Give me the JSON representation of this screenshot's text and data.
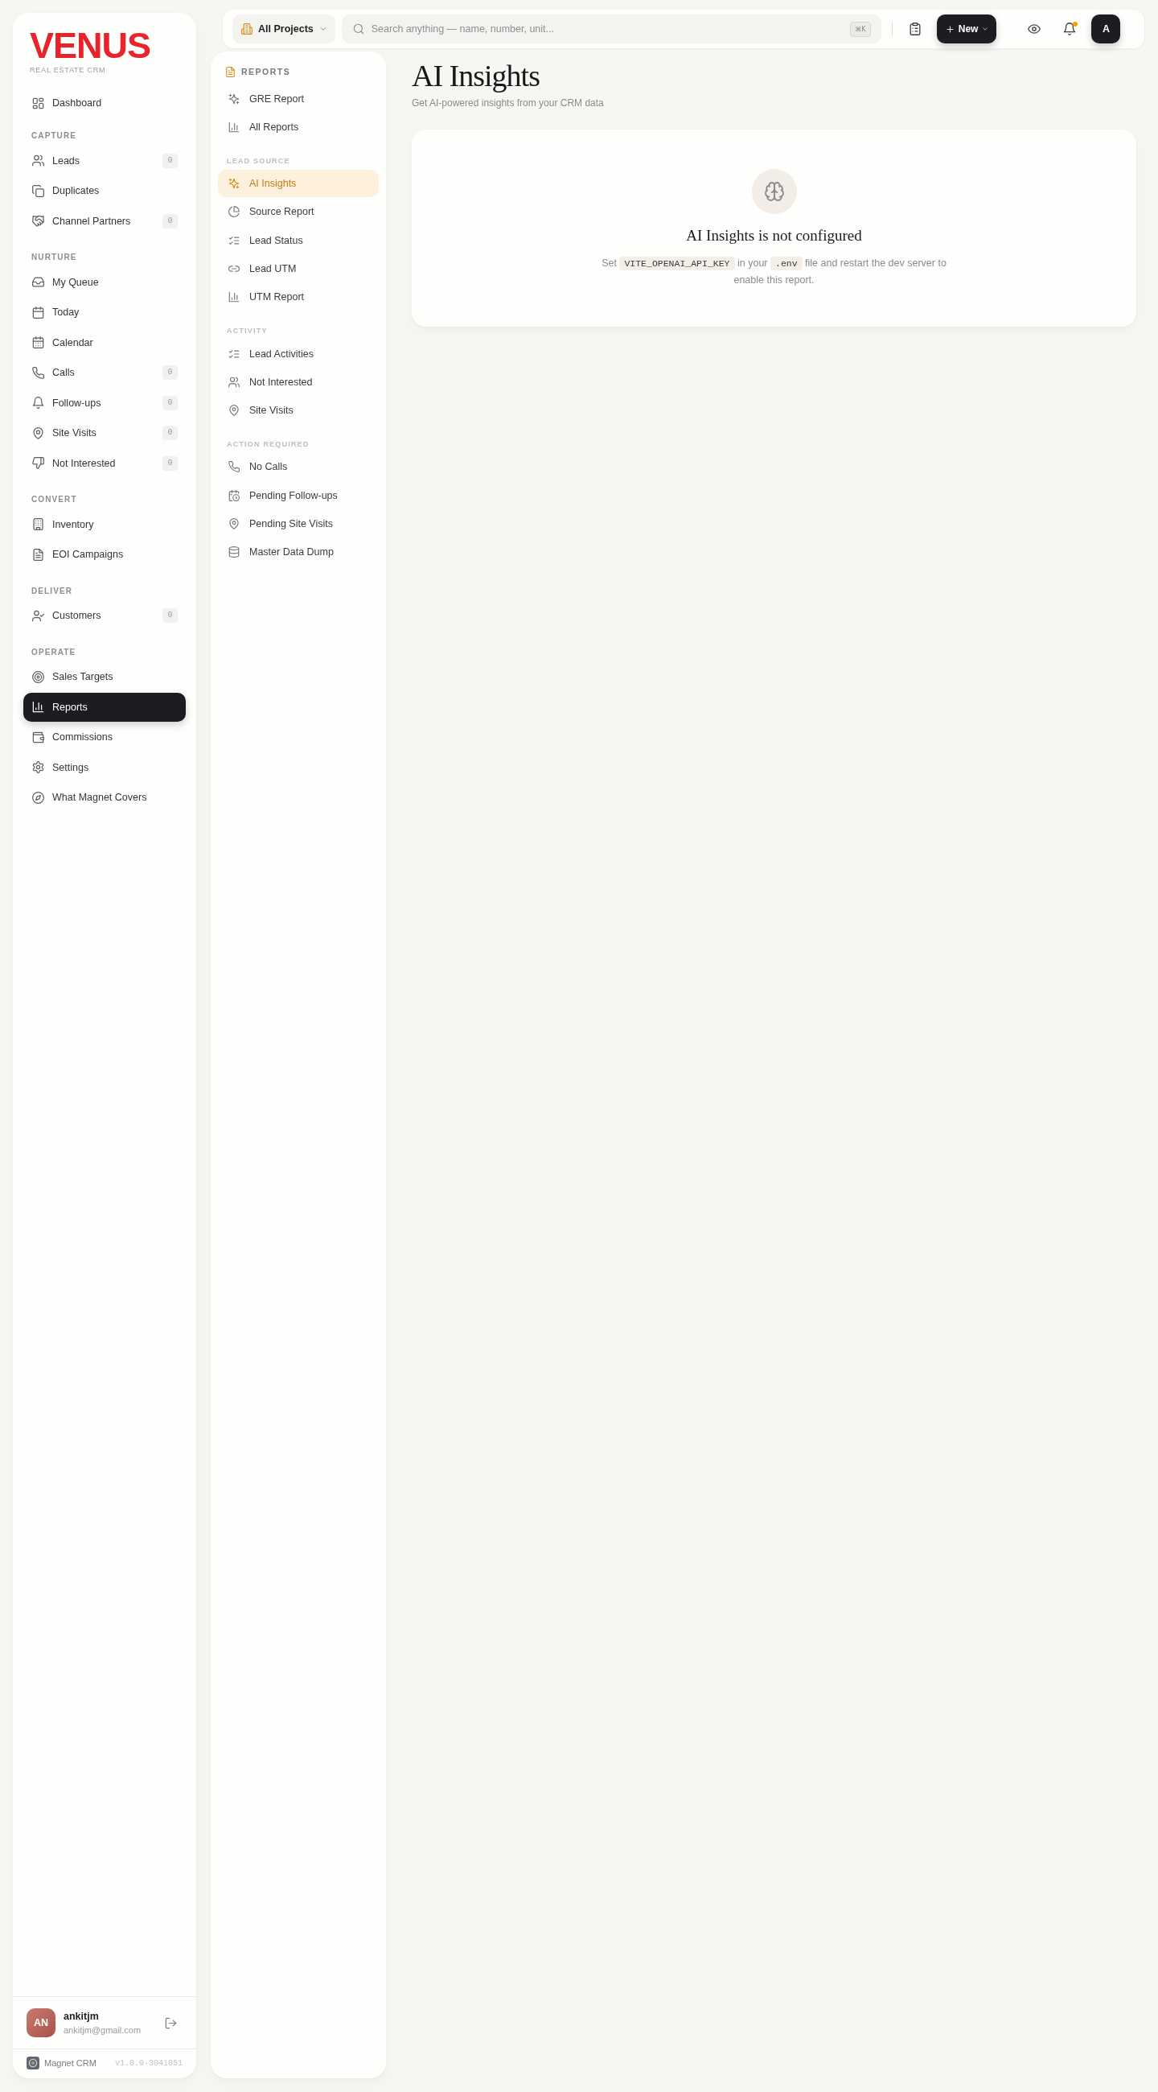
{
  "sidebar": {
    "logo": "VENUS",
    "tagline": "REAL ESTATE CRM",
    "nav": [
      {
        "items": [
          {
            "label": "Dashboard",
            "selected": false
          }
        ]
      },
      {
        "heading": "CAPTURE",
        "items": [
          {
            "label": "Leads",
            "badge": "0",
            "selected": false
          },
          {
            "label": "Duplicates",
            "selected": false
          },
          {
            "label": "Channel Partners",
            "badge": "0",
            "selected": false
          }
        ]
      },
      {
        "heading": "NURTURE",
        "items": [
          {
            "label": "My Queue",
            "selected": false
          },
          {
            "label": "Today",
            "selected": false
          },
          {
            "label": "Calendar",
            "selected": false
          },
          {
            "label": "Calls",
            "badge": "0",
            "selected": false
          },
          {
            "label": "Follow-ups",
            "badge": "0",
            "selected": false
          },
          {
            "label": "Site Visits",
            "badge": "0",
            "selected": false
          },
          {
            "label": "Not Interested",
            "badge": "0",
            "selected": false
          }
        ]
      },
      {
        "heading": "CONVERT",
        "items": [
          {
            "label": "Inventory",
            "selected": false
          },
          {
            "label": "EOI Campaigns",
            "selected": false
          }
        ]
      },
      {
        "heading": "DELIVER",
        "items": [
          {
            "label": "Customers",
            "badge": "0",
            "selected": false
          }
        ]
      },
      {
        "heading": "OPERATE",
        "items": [
          {
            "label": "Sales Targets",
            "selected": false
          },
          {
            "label": "Reports",
            "selected": true
          },
          {
            "label": "Commissions",
            "selected": false
          },
          {
            "label": "Settings",
            "selected": false
          },
          {
            "label": "What Magnet Covers",
            "selected": false
          }
        ]
      }
    ],
    "user": {
      "initials": "AN",
      "name": "ankitjm",
      "email": "ankitjm@gmail.com"
    },
    "footer": {
      "app_name": "Magnet CRM",
      "version": "v1.0.0·3041051"
    }
  },
  "top_bar": {
    "project_picker": "All Projects",
    "search": {
      "placeholder": "Search anything — name, number, unit...",
      "shortcut": "⌘K"
    },
    "new_button": "New",
    "notifications": {
      "unread": true
    },
    "avatar": "A"
  },
  "reports_nav": {
    "title": "REPORTS",
    "groups": [
      {
        "items": [
          {
            "label": "GRE Report",
            "selected": false
          },
          {
            "label": "All Reports",
            "selected": false
          }
        ]
      },
      {
        "heading": "LEAD SOURCE",
        "items": [
          {
            "label": "AI Insights",
            "selected": true
          },
          {
            "label": "Source Report",
            "selected": false
          },
          {
            "label": "Lead Status",
            "selected": false
          },
          {
            "label": "Lead UTM",
            "selected": false
          },
          {
            "label": "UTM Report",
            "selected": false
          }
        ]
      },
      {
        "heading": "ACTIVITY",
        "items": [
          {
            "label": "Lead Activities",
            "selected": false
          },
          {
            "label": "Not Interested",
            "selected": false
          },
          {
            "label": "Site Visits",
            "selected": false
          }
        ]
      },
      {
        "heading": "ACTION REQUIRED",
        "items": [
          {
            "label": "No Calls",
            "selected": false
          },
          {
            "label": "Pending Follow-ups",
            "selected": false
          },
          {
            "label": "Pending Site Visits",
            "selected": false
          },
          {
            "label": "Master Data Dump",
            "selected": false
          }
        ]
      }
    ]
  },
  "page": {
    "title": "AI Insights",
    "subtitle": "Get AI-powered insights from your CRM data",
    "empty_state": {
      "heading": "AI Insights is not configured",
      "message": [
        {
          "kind": "text",
          "text": "Set"
        },
        {
          "kind": "code",
          "text": "VITE_OPENAI_API_KEY"
        },
        {
          "kind": "text",
          "text": "in your"
        },
        {
          "kind": "code",
          "text": ".env"
        },
        {
          "kind": "text",
          "text": "file and restart the dev server to enable this report."
        }
      ]
    }
  }
}
